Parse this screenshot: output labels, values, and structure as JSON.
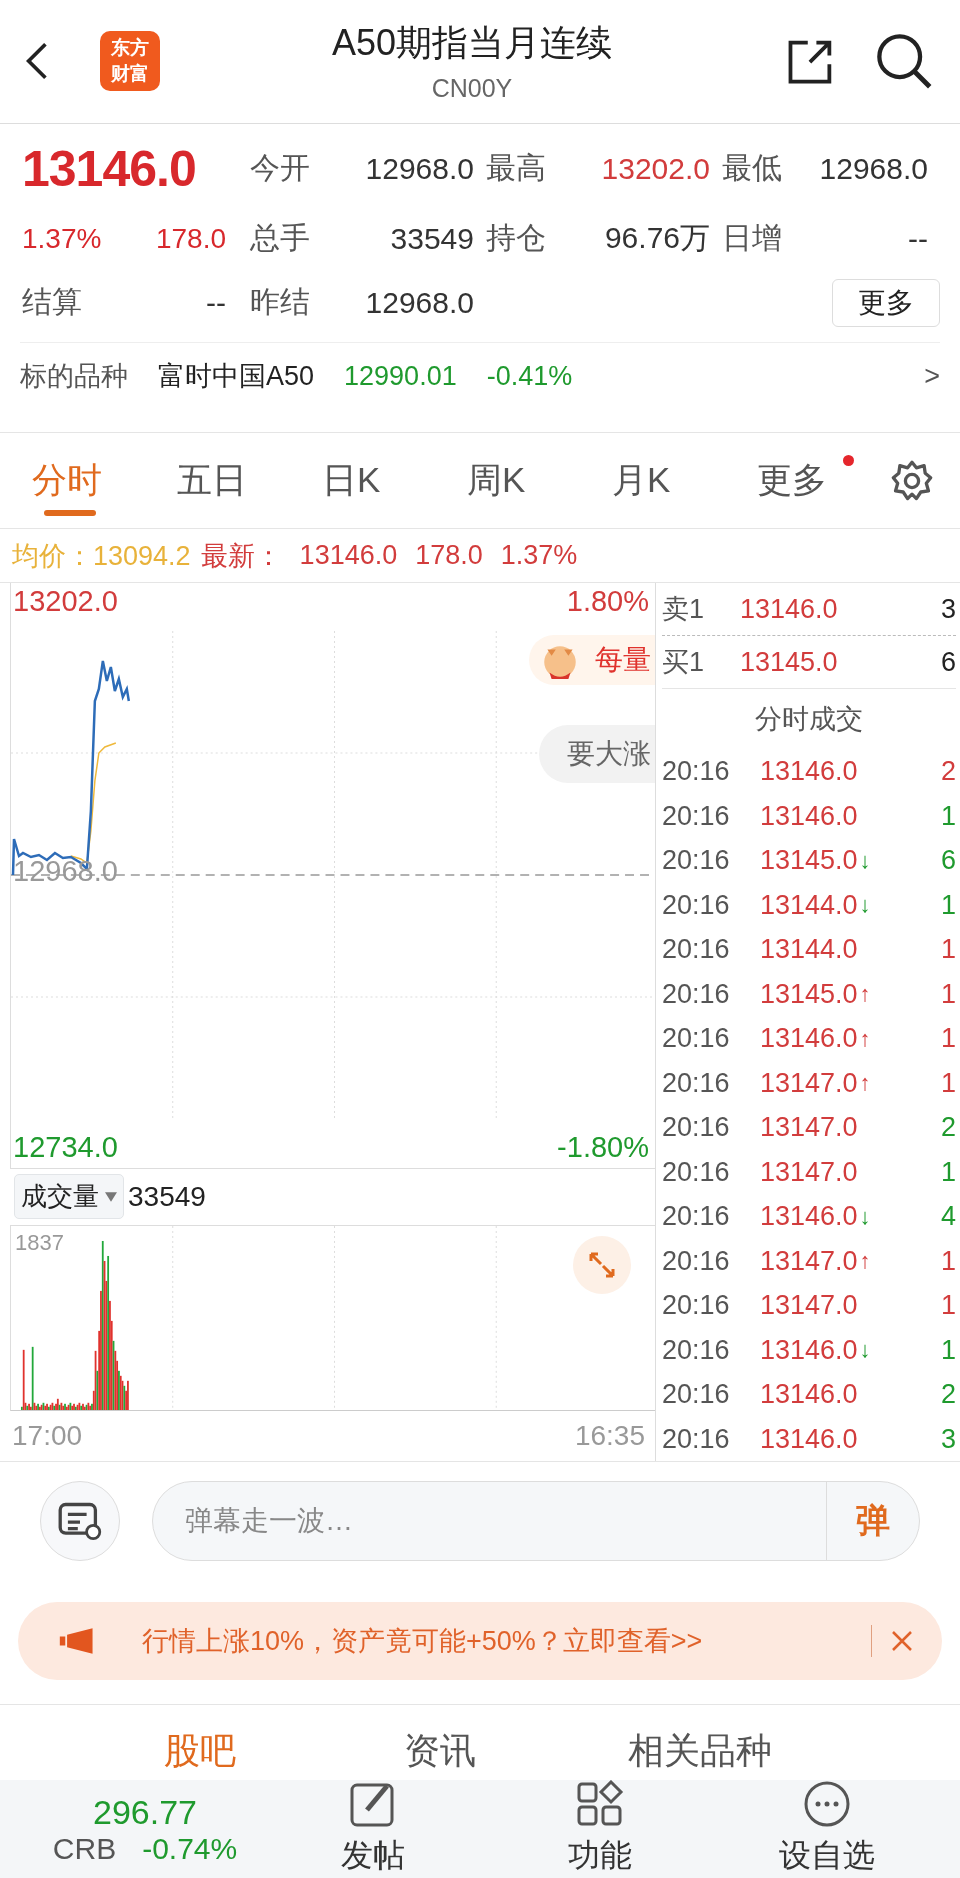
{
  "header": {
    "logo": [
      "东方",
      "财富"
    ],
    "title": "A50期指当月连续",
    "code": "CN00Y"
  },
  "quote": {
    "price": "13146.0",
    "change_pct": "1.37%",
    "change": "178.0",
    "settle_label": "结算",
    "settle": "--",
    "more": "更多",
    "fields": [
      {
        "label": "今开",
        "value": "12968.0",
        "color": "#333333"
      },
      {
        "label": "最高",
        "value": "13202.0",
        "color": "#d23c3c"
      },
      {
        "label": "最低",
        "value": "12968.0",
        "color": "#333333"
      },
      {
        "label": "总手",
        "value": "33549",
        "color": "#333333"
      },
      {
        "label": "持仓",
        "value": "96.76万",
        "color": "#333333"
      },
      {
        "label": "日增",
        "value": "--",
        "color": "#333333"
      },
      {
        "label": "昨结",
        "value": "12968.0",
        "color": "#333333"
      }
    ]
  },
  "underlying": {
    "label": "标的品种",
    "name": "富时中国A50",
    "price": "12990.01",
    "change": "-0.41%",
    "arrow": ">"
  },
  "tabs": [
    {
      "label": "分时",
      "selected": true,
      "dot": false
    },
    {
      "label": "五日",
      "selected": false,
      "dot": false
    },
    {
      "label": "日K",
      "selected": false,
      "dot": false
    },
    {
      "label": "周K",
      "selected": false,
      "dot": false
    },
    {
      "label": "月K",
      "selected": false,
      "dot": false
    },
    {
      "label": "更多",
      "selected": false,
      "dot": true
    }
  ],
  "summary": {
    "avg_label": "均价：",
    "avg": "13094.2",
    "latest_label": "最新：",
    "latest": "13146.0",
    "change": "178.0",
    "pct": "1.37%"
  },
  "chart": {
    "high": "13202.0",
    "base": "12968.0",
    "low": "12734.0",
    "high_pct": "1.80%",
    "low_pct": "-1.80%",
    "promo": "每量",
    "tag": "要大涨"
  },
  "volume": {
    "label": "成交量",
    "value": "33549",
    "max": "1837",
    "start": "17:00",
    "end": "16:35"
  },
  "book": [
    {
      "side": "卖1",
      "price": "13146.0",
      "qty": "3"
    },
    {
      "side": "买1",
      "price": "13145.0",
      "qty": "6"
    }
  ],
  "trades_title": "分时成交",
  "trades": [
    {
      "time": "20:16",
      "price": "13146.0",
      "qty": "2",
      "color": "#d23c3c"
    },
    {
      "time": "20:16",
      "price": "13146.0",
      "qty": "1",
      "color": "#1f9a2e"
    },
    {
      "time": "20:16",
      "price": "13145.0",
      "arrow": "↓",
      "arrow_up": false,
      "qty": "6",
      "color": "#1f9a2e"
    },
    {
      "time": "20:16",
      "price": "13144.0",
      "arrow": "↓",
      "arrow_up": false,
      "qty": "1",
      "color": "#1f9a2e"
    },
    {
      "time": "20:16",
      "price": "13144.0",
      "qty": "1",
      "color": "#d23c3c"
    },
    {
      "time": "20:16",
      "price": "13145.0",
      "arrow": "↑",
      "arrow_up": true,
      "qty": "1",
      "color": "#d23c3c"
    },
    {
      "time": "20:16",
      "price": "13146.0",
      "arrow": "↑",
      "arrow_up": true,
      "qty": "1",
      "color": "#d23c3c"
    },
    {
      "time": "20:16",
      "price": "13147.0",
      "arrow": "↑",
      "arrow_up": true,
      "qty": "1",
      "color": "#d23c3c"
    },
    {
      "time": "20:16",
      "price": "13147.0",
      "qty": "2",
      "color": "#1f9a2e"
    },
    {
      "time": "20:16",
      "price": "13147.0",
      "qty": "1",
      "color": "#1f9a2e"
    },
    {
      "time": "20:16",
      "price": "13146.0",
      "arrow": "↓",
      "arrow_up": false,
      "qty": "4",
      "color": "#1f9a2e"
    },
    {
      "time": "20:16",
      "price": "13147.0",
      "arrow": "↑",
      "arrow_up": true,
      "qty": "1",
      "color": "#d23c3c"
    },
    {
      "time": "20:16",
      "price": "13147.0",
      "qty": "1",
      "color": "#d23c3c"
    },
    {
      "time": "20:16",
      "price": "13146.0",
      "arrow": "↓",
      "arrow_up": false,
      "qty": "1",
      "color": "#1f9a2e"
    },
    {
      "time": "20:16",
      "price": "13146.0",
      "qty": "2",
      "color": "#1f9a2e"
    },
    {
      "time": "20:16",
      "price": "13146.0",
      "qty": "3",
      "color": "#1f9a2e"
    }
  ],
  "comment": {
    "placeholder": "弹幕走一波…",
    "send": "弹"
  },
  "banner": {
    "text": "行情上涨10%，资产竟可能+50%？立即查看>>"
  },
  "bottom_tabs": [
    {
      "label": "股吧",
      "selected": true
    },
    {
      "label": "资讯",
      "selected": false
    },
    {
      "label": "相关品种",
      "selected": false
    }
  ],
  "footer": {
    "index_value": "296.77",
    "index_name": "CRB",
    "index_change": "-0.74%",
    "actions": [
      {
        "label": "发帖",
        "kind": "post"
      },
      {
        "label": "功能",
        "kind": "grid"
      },
      {
        "label": "设自选",
        "kind": "more"
      }
    ]
  }
}
